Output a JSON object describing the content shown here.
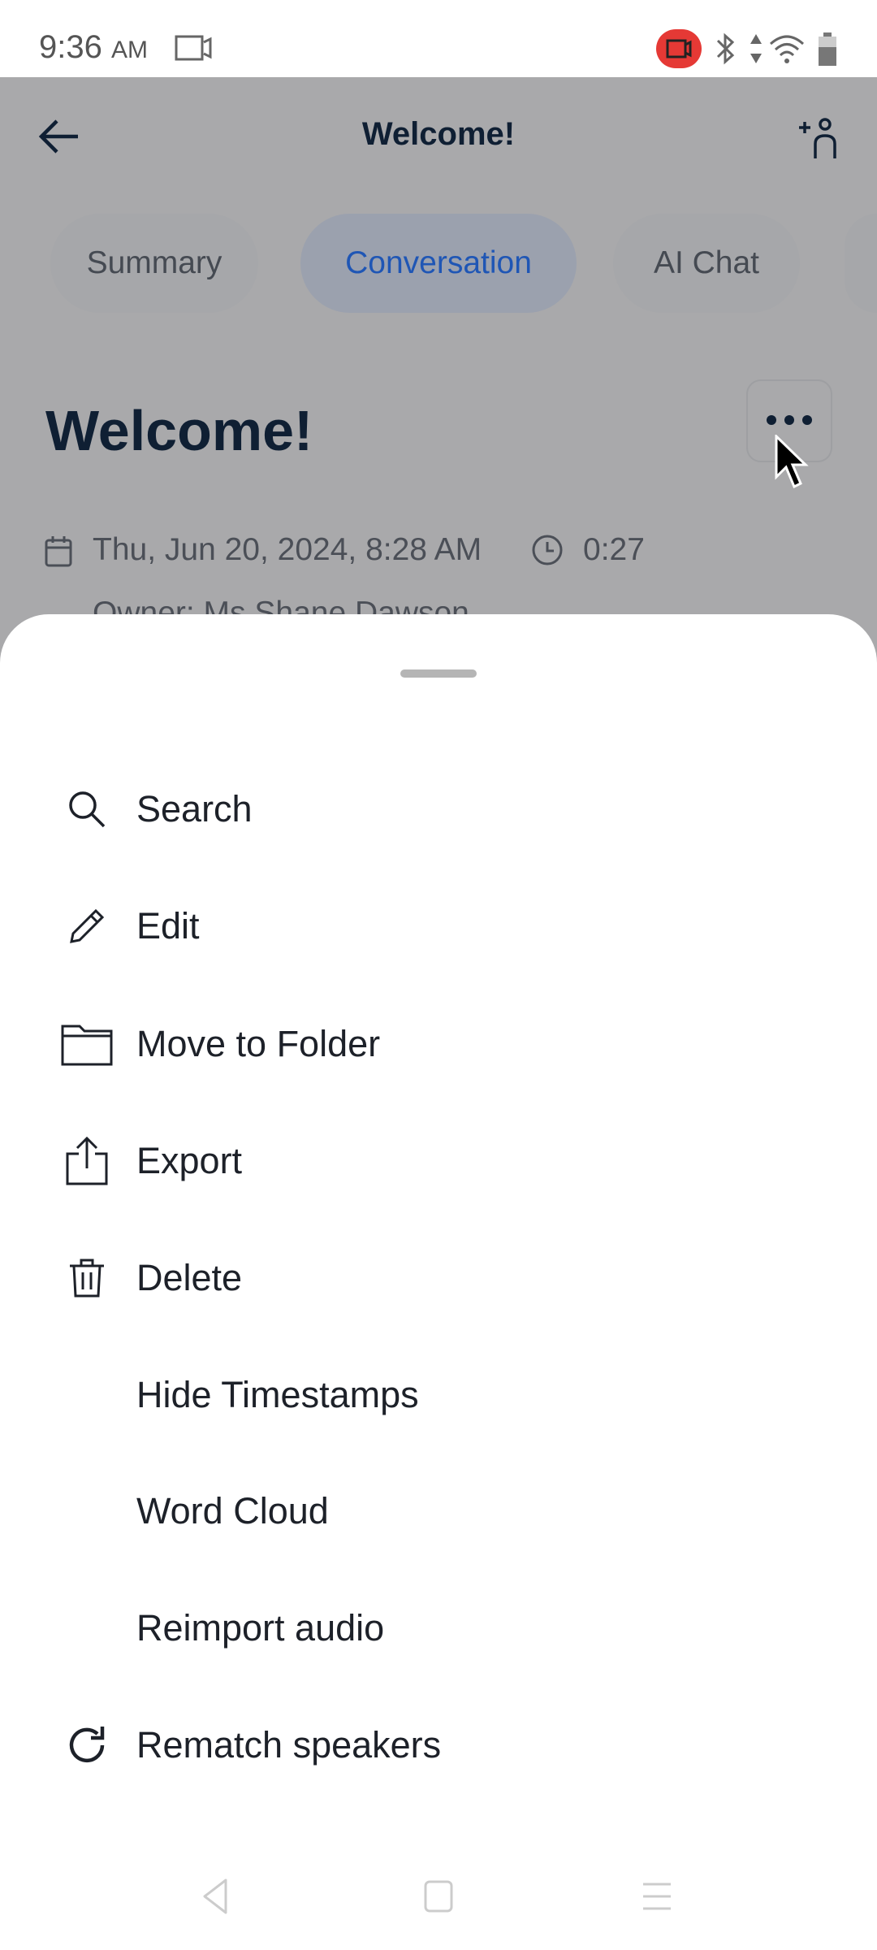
{
  "status_bar": {
    "time": "9:36",
    "ampm": "AM"
  },
  "header": {
    "title": "Welcome!"
  },
  "tabs": [
    {
      "label": "Summary"
    },
    {
      "label": "Conversation",
      "active": true
    },
    {
      "label": "AI Chat"
    }
  ],
  "recording": {
    "title": "Welcome!",
    "date": "Thu, Jun 20, 2024, 8:28 AM",
    "duration": "0:27",
    "owner": "Owner: Ms Shane Dawson"
  },
  "menu": {
    "items": [
      {
        "label": "Search",
        "icon": "search-icon"
      },
      {
        "label": "Edit",
        "icon": "pencil-icon"
      },
      {
        "label": "Move to Folder",
        "icon": "folder-icon"
      },
      {
        "label": "Export",
        "icon": "share-icon"
      },
      {
        "label": "Delete",
        "icon": "trash-icon"
      },
      {
        "label": "Hide Timestamps",
        "icon": ""
      },
      {
        "label": "Word Cloud",
        "icon": ""
      },
      {
        "label": "Reimport audio",
        "icon": ""
      },
      {
        "label": "Rematch speakers",
        "icon": "refresh-icon"
      }
    ]
  },
  "colors": {
    "accent": "#1f56b5",
    "recording": "#e53935",
    "overlay": "#a9a9ab"
  }
}
